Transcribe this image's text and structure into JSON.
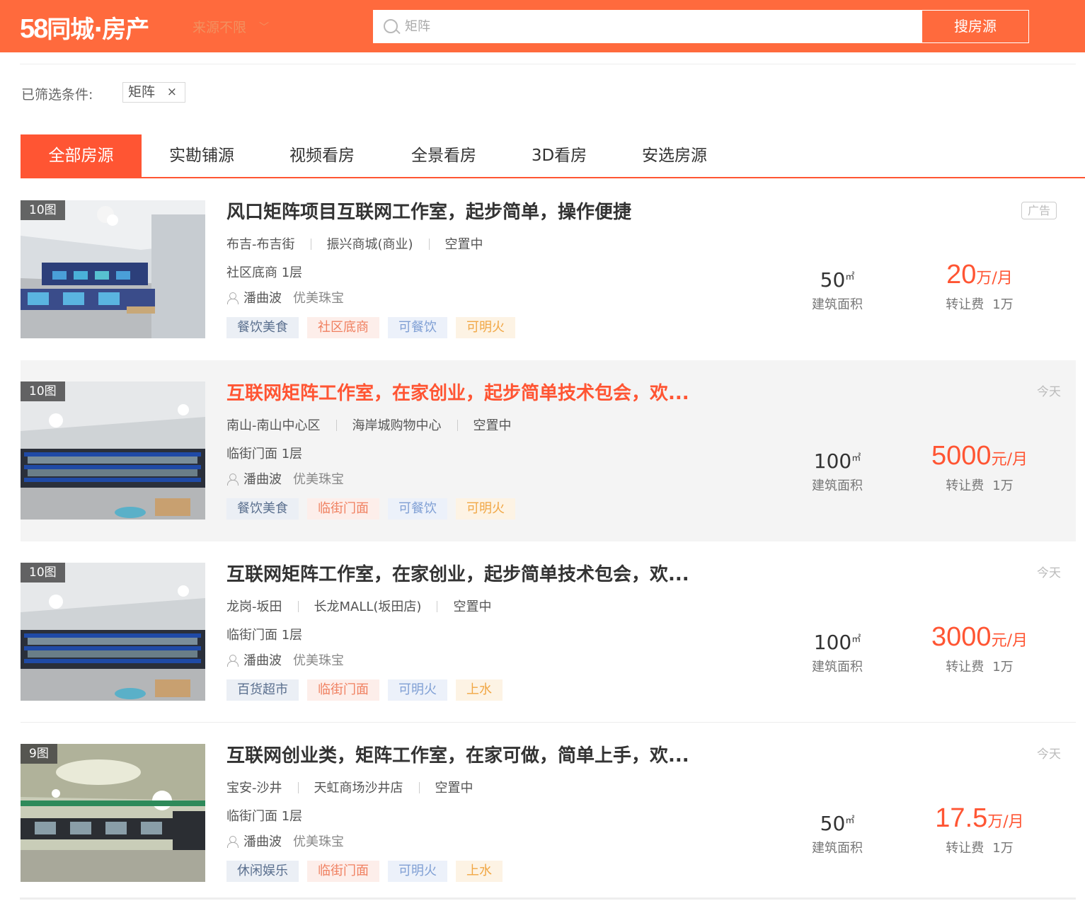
{
  "header": {
    "logo_num": "58",
    "logo_text": "同城·房产",
    "source_select": "来源不限",
    "search_placeholder": "矩阵",
    "search_button": "搜房源"
  },
  "filter": {
    "label": "已筛选条件:",
    "tag": "矩阵",
    "tag_close": "×"
  },
  "tabs": [
    "全部房源",
    "实勘铺源",
    "视频看房",
    "全景看房",
    "3D看房",
    "安选房源"
  ],
  "listings": [
    {
      "img_count": "10图",
      "title": "风口矩阵项目互联网工作室，起步简单，操作便捷",
      "district": "布吉-布吉街",
      "mall": "振兴商城(商业)",
      "status": "空置中",
      "floor": "社区底商 1层",
      "agent": "潘曲波",
      "company": "优美珠宝",
      "tags": [
        "餐饮美食",
        "社区底商",
        "可餐饮",
        "可明火"
      ],
      "area": "50",
      "area_unit": "㎡",
      "area_label": "建筑面积",
      "price": "20",
      "price_unit": "万/月",
      "fee_label": "转让费",
      "fee": "1万",
      "badge": "广告"
    },
    {
      "img_count": "10图",
      "title": "互联网矩阵工作室，在家创业，起步简单技术包会，欢...",
      "district": "南山-南山中心区",
      "mall": "海岸城购物中心",
      "status": "空置中",
      "floor": "临街门面 1层",
      "agent": "潘曲波",
      "company": "优美珠宝",
      "tags": [
        "餐饮美食",
        "临街门面",
        "可餐饮",
        "可明火"
      ],
      "area": "100",
      "area_unit": "㎡",
      "area_label": "建筑面积",
      "price": "5000",
      "price_unit": "元/月",
      "fee_label": "转让费",
      "fee": "1万",
      "date": "今天"
    },
    {
      "img_count": "10图",
      "title": "互联网矩阵工作室，在家创业，起步简单技术包会，欢...",
      "district": "龙岗-坂田",
      "mall": "长龙MALL(坂田店)",
      "status": "空置中",
      "floor": "临街门面 1层",
      "agent": "潘曲波",
      "company": "优美珠宝",
      "tags": [
        "百货超市",
        "临街门面",
        "可明火",
        "上水"
      ],
      "area": "100",
      "area_unit": "㎡",
      "area_label": "建筑面积",
      "price": "3000",
      "price_unit": "元/月",
      "fee_label": "转让费",
      "fee": "1万",
      "date": "今天"
    },
    {
      "img_count": "9图",
      "title": "互联网创业类，矩阵工作室，在家可做，简单上手，欢...",
      "district": "宝安-沙井",
      "mall": "天虹商场沙井店",
      "status": "空置中",
      "floor": "临街门面 1层",
      "agent": "潘曲波",
      "company": "优美珠宝",
      "tags": [
        "休闲娱乐",
        "临街门面",
        "可明火",
        "上水"
      ],
      "area": "50",
      "area_unit": "㎡",
      "area_label": "建筑面积",
      "price": "17.5",
      "price_unit": "万/月",
      "fee_label": "转让费",
      "fee": "1万",
      "date": "今天"
    }
  ],
  "colors": {
    "brand": "#ff6a3d",
    "accent": "#ff5533"
  }
}
